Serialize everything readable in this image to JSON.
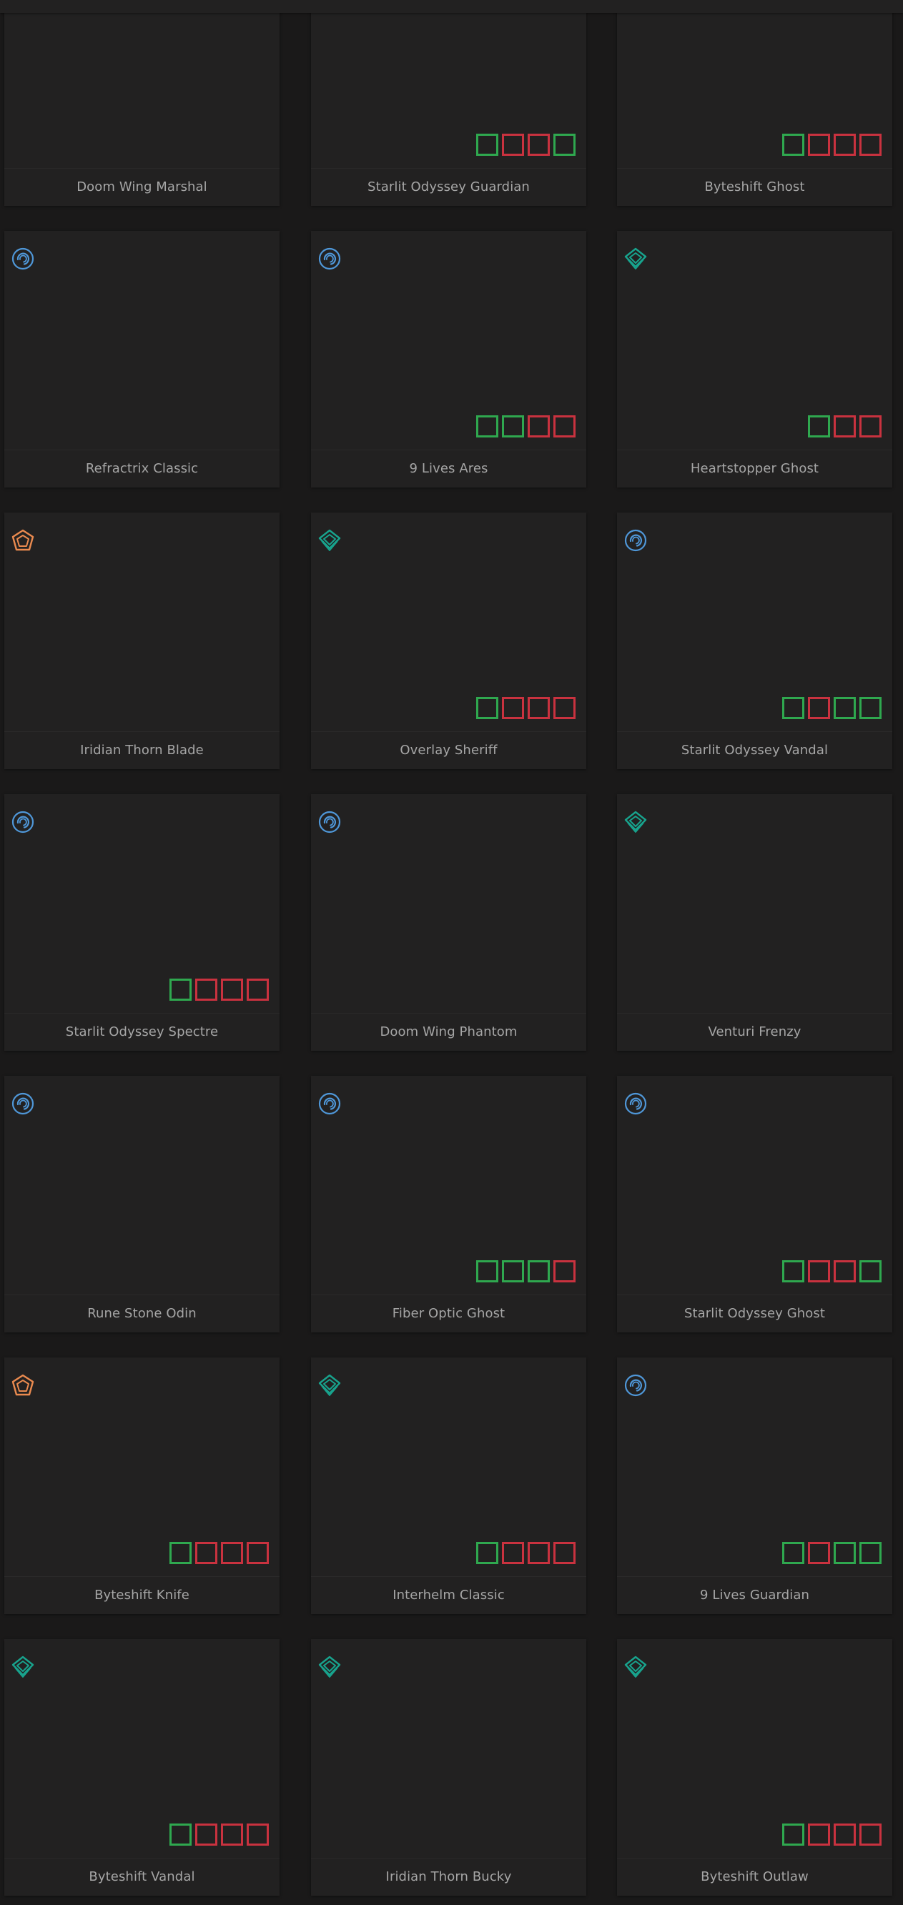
{
  "colors": {
    "background": "#1a1919",
    "card": "#222121",
    "name_text": "#a6a6a6",
    "tier_on": "#2fa84f",
    "tier_off": "#c9323f",
    "icon_blue": "#4f97d8",
    "icon_teal": "#18a38d",
    "icon_orange": "#ea8a4f"
  },
  "cards": [
    {
      "name": "Doom Wing Marshal",
      "icon": null,
      "tiers": []
    },
    {
      "name": "Starlit Odyssey Guardian",
      "icon": null,
      "tiers": [
        "green",
        "red",
        "red",
        "green"
      ]
    },
    {
      "name": "Byteshift Ghost",
      "icon": null,
      "tiers": [
        "green",
        "red",
        "red",
        "red"
      ]
    },
    {
      "name": "Refractrix Classic",
      "icon": "blue-swirl-icon",
      "tiers": []
    },
    {
      "name": "9 Lives Ares",
      "icon": "blue-swirl-icon",
      "tiers": [
        "green",
        "green",
        "red",
        "red"
      ]
    },
    {
      "name": "Heartstopper Ghost",
      "icon": "teal-diamond-icon",
      "tiers": [
        "green",
        "red",
        "red"
      ]
    },
    {
      "name": "Iridian Thorn Blade",
      "icon": "orange-pentagon-icon",
      "tiers": []
    },
    {
      "name": "Overlay Sheriff",
      "icon": "teal-diamond-icon",
      "tiers": [
        "green",
        "red",
        "red",
        "red"
      ]
    },
    {
      "name": "Starlit Odyssey Vandal",
      "icon": "blue-swirl-icon",
      "tiers": [
        "green",
        "red",
        "green",
        "green"
      ]
    },
    {
      "name": "Starlit Odyssey Spectre",
      "icon": "blue-swirl-icon",
      "tiers": [
        "green",
        "red",
        "red",
        "red"
      ]
    },
    {
      "name": "Doom Wing Phantom",
      "icon": "blue-swirl-icon",
      "tiers": []
    },
    {
      "name": "Venturi Frenzy",
      "icon": "teal-diamond-icon",
      "tiers": []
    },
    {
      "name": "Rune Stone Odin",
      "icon": "blue-swirl-icon",
      "tiers": []
    },
    {
      "name": "Fiber Optic Ghost",
      "icon": "blue-swirl-icon",
      "tiers": [
        "green",
        "green",
        "green",
        "red"
      ]
    },
    {
      "name": "Starlit Odyssey Ghost",
      "icon": "blue-swirl-icon",
      "tiers": [
        "green",
        "red",
        "red",
        "green"
      ]
    },
    {
      "name": "Byteshift Knife",
      "icon": "orange-pentagon-icon",
      "tiers": [
        "green",
        "red",
        "red",
        "red"
      ]
    },
    {
      "name": "Interhelm Classic",
      "icon": "teal-diamond-icon",
      "tiers": [
        "green",
        "red",
        "red",
        "red"
      ]
    },
    {
      "name": "9 Lives Guardian",
      "icon": "blue-swirl-icon",
      "tiers": [
        "green",
        "red",
        "green",
        "green"
      ]
    },
    {
      "name": "Byteshift Vandal",
      "icon": "teal-diamond-icon",
      "tiers": [
        "green",
        "red",
        "red",
        "red"
      ]
    },
    {
      "name": "Iridian Thorn Bucky",
      "icon": "teal-diamond-icon",
      "tiers": []
    },
    {
      "name": "Byteshift Outlaw",
      "icon": "teal-diamond-icon",
      "tiers": [
        "green",
        "red",
        "red",
        "red"
      ]
    }
  ]
}
